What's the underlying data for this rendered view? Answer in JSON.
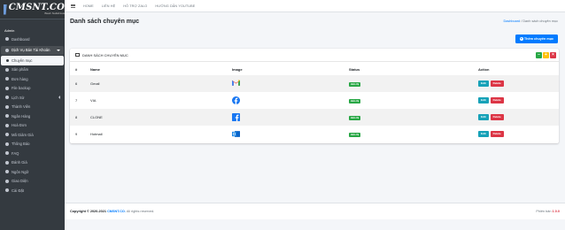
{
  "brand": {
    "name": "CMSNT.CO",
    "tagline": "Best Solution"
  },
  "sidebar": {
    "section": "Admin",
    "items": [
      {
        "label": "Dashboard",
        "icon": "dashboard-icon"
      },
      {
        "label": "Dịch Vụ Bán Tài Khoản",
        "icon": "cart-icon",
        "open": true
      },
      {
        "label": "Chuyên mục",
        "icon": "dot-icon",
        "active": true
      },
      {
        "label": "Sản phẩm",
        "icon": "box-icon"
      },
      {
        "label": "Đơn hàng",
        "icon": "orders-icon"
      },
      {
        "label": "File backup",
        "icon": "file-icon"
      },
      {
        "label": "Lịch Sử",
        "icon": "history-icon",
        "caret": true
      },
      {
        "label": "Thành Viên",
        "icon": "users-icon"
      },
      {
        "label": "Ngân Hàng",
        "icon": "bank-icon"
      },
      {
        "label": "Hoá Đơn",
        "icon": "invoice-icon"
      },
      {
        "label": "Mã Giảm Giá",
        "icon": "coupon-icon"
      },
      {
        "label": "Thông Báo",
        "icon": "bell-icon"
      },
      {
        "label": "FAQ",
        "icon": "question-icon"
      },
      {
        "label": "Đánh Giá",
        "icon": "star-icon"
      },
      {
        "label": "Ngôn Ngữ",
        "icon": "language-icon"
      },
      {
        "label": "Giao Diện",
        "icon": "theme-icon"
      },
      {
        "label": "Cài Đặt",
        "icon": "gear-icon"
      }
    ]
  },
  "topbar": {
    "links": [
      "HOME",
      "LIÊN HỆ",
      "HỖ TRỢ ZALO",
      "HƯỚNG DẪN YOUTUBE"
    ]
  },
  "page": {
    "title": "Danh sách chuyên mục",
    "breadcrumb": {
      "home": "Dashboard",
      "sep": "/",
      "current": "Danh sách chuyên mục"
    },
    "add_button": "Thêm chuyên mục"
  },
  "card": {
    "title": "DANH SÁCH CHUYÊN MỤC",
    "columns": [
      "#",
      "Name",
      "Image",
      "Status",
      "Action"
    ],
    "rows": [
      {
        "id": "6",
        "name": "Gmail",
        "image": "gmail-logo",
        "status": "Hiển thị",
        "edit": "Edit",
        "delete": "Delete"
      },
      {
        "id": "7",
        "name": "VIA",
        "image": "facebook-logo",
        "status": "Hiển thị",
        "edit": "Edit",
        "delete": "Delete"
      },
      {
        "id": "8",
        "name": "CLONE",
        "image": "facebook-square-logo",
        "status": "Hiển thị",
        "edit": "Edit",
        "delete": "Delete"
      },
      {
        "id": "9",
        "name": "Hotmail",
        "image": "outlook-logo",
        "status": "Hiển thị",
        "edit": "Edit",
        "delete": "Delete"
      }
    ]
  },
  "footer": {
    "copy_prefix": "Copyright © 2020-2021",
    "copy_brand": "CMSNT.CO.",
    "copy_suffix": "All rights reserved.",
    "version_label": "Phiên bản",
    "version": "1.0.0"
  },
  "colors": {
    "primary": "#007bff",
    "success": "#28a745",
    "danger": "#dc3545",
    "info": "#17a2b8",
    "sidebar": "#343a40"
  }
}
